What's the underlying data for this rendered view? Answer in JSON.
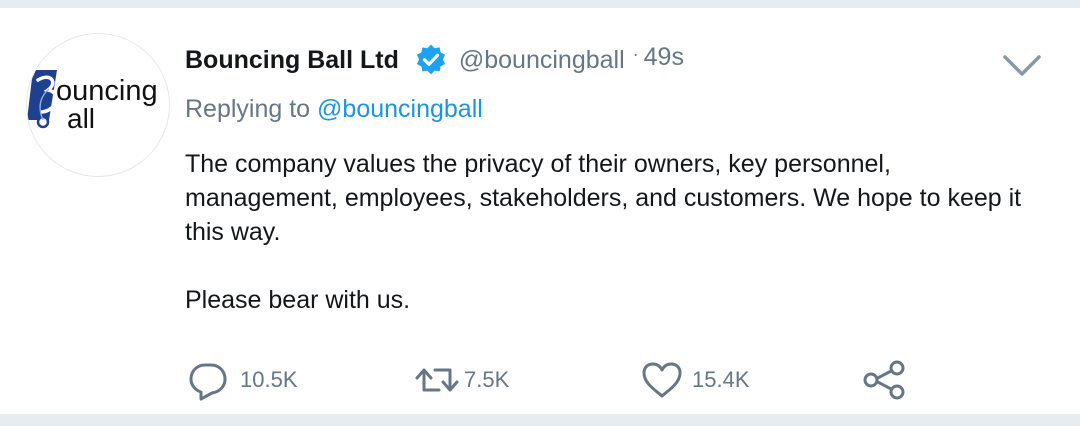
{
  "tweet": {
    "avatar": {
      "alt": "Bouncing Ball logo",
      "text_line1": "ouncing",
      "text_line2": "all"
    },
    "display_name": "Bouncing Ball Ltd",
    "verified_icon": "verified-badge-icon",
    "handle": "@bouncingball",
    "separator": "·",
    "time": "49s",
    "more_icon": "chevron-down-icon",
    "replying_prefix": "Replying to",
    "replying_handle": "@bouncingball",
    "paragraphs": [
      "The company values the privacy of their owners, key personnel, management, employees, stakeholders, and customers. We hope to keep it this way.",
      "Please bear with us."
    ],
    "actions": {
      "reply": {
        "icon": "reply-icon",
        "count": "10.5K"
      },
      "retweet": {
        "icon": "retweet-icon",
        "count": "7.5K"
      },
      "like": {
        "icon": "heart-icon",
        "count": "15.4K"
      },
      "share": {
        "icon": "share-icon"
      }
    }
  },
  "colors": {
    "text_primary": "#14171a",
    "text_secondary": "#657786",
    "link": "#1b95e0",
    "verified": "#1da1f2",
    "logo_blue": "#1f3f8f",
    "divider": "#e6ecf0"
  }
}
